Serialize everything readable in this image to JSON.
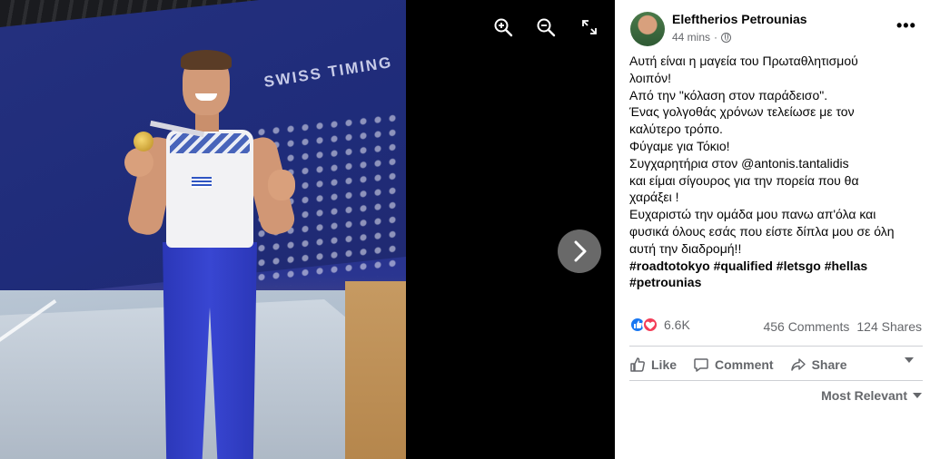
{
  "viewer": {
    "zoom_in_icon": "zoom-in-icon",
    "zoom_out_icon": "zoom-out-icon",
    "fullscreen_icon": "fullscreen-icon",
    "next_icon": "chevron-right-icon",
    "photo_text": {
      "swiss_timing": "SWISS TIMING"
    }
  },
  "post": {
    "author": "Eleftherios Petrounias",
    "time": "44 mins",
    "separator": "·",
    "more": "•••",
    "lines": [
      "Αυτή είναι η μαγεία του Πρωταθλητισμού",
      "λοιπόν!",
      "Από την \"κόλαση στον παράδεισο\".",
      "Ένας γολγοθάς χρόνων τελείωσε με τον",
      "καλύτερο τρόπο.",
      "Φύγαμε για Τόκιο!",
      "Συγχαρητήρια στον @antonis.tantalidis",
      "και είμαι σίγουρος για την πορεία που θα",
      "χαράξει !",
      "Ευχαριστώ την ομάδα μου πανω απ'όλα και",
      "φυσικά όλους εσάς που είστε δίπλα μου σε όλη",
      "αυτή την διαδρομή!!"
    ],
    "hashtags_line1": "#roadtotokyo #qualified #letsgo #hellas",
    "hashtags_line2": "#petrounias",
    "reaction_count": "6.6K",
    "comments": "456 Comments",
    "shares": "124 Shares",
    "actions": {
      "like": "Like",
      "comment": "Comment",
      "share": "Share"
    },
    "sort_label": "Most Relevant"
  },
  "colors": {
    "like_blue": "#1877f2",
    "love_red": "#f33e58",
    "muted_text": "#65676b"
  }
}
